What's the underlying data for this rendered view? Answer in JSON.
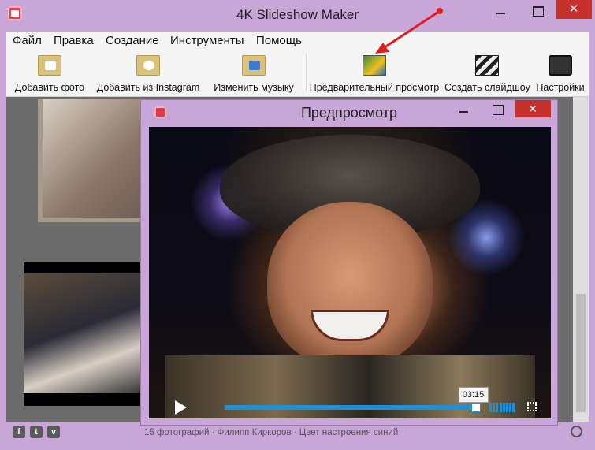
{
  "app": {
    "title": "4K Slideshow Maker",
    "close_glyph": "✕",
    "icon": "app-logo-icon"
  },
  "menu": {
    "items": [
      "Файл",
      "Правка",
      "Создание",
      "Инструменты",
      "Помощь"
    ]
  },
  "toolbar": {
    "buttons": [
      {
        "label": "Добавить фото",
        "icon": "add-photo-folder-icon"
      },
      {
        "label": "Добавить из Instagram",
        "icon": "instagram-folder-icon"
      },
      {
        "label": "Изменить музыку",
        "icon": "music-folder-icon"
      },
      {
        "label": "Предварительный просмотр",
        "icon": "preview-image-icon"
      },
      {
        "label": "Создать слайдшоу",
        "icon": "clapperboard-icon"
      },
      {
        "label": "Настройки",
        "icon": "settings-monitor-icon"
      }
    ]
  },
  "status": {
    "text": "15 фотографий · Филипп Киркоров · Цвет настроения синий",
    "social": [
      "f",
      "t",
      "v"
    ]
  },
  "preview": {
    "title": "Предпросмотр",
    "close_glyph": "✕",
    "time": "03:15",
    "progress": 0.98,
    "volume_bars": 8
  },
  "colors": {
    "window_bg": "#c9a6d8",
    "close_red": "#c7312b",
    "accent_blue": "#1f8fd6",
    "arrow_red": "#e0201c"
  }
}
